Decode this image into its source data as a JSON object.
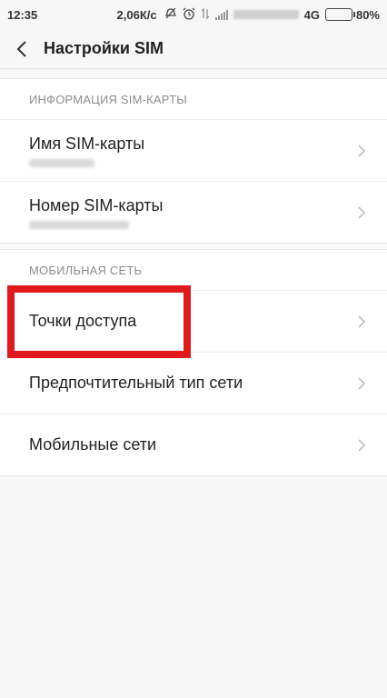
{
  "status_bar": {
    "time": "12:35",
    "speed": "2,06К/с",
    "network": "4G",
    "battery_percent": "80%",
    "battery_level": 0.8
  },
  "header": {
    "title": "Настройки SIM"
  },
  "sim_info": {
    "section_title": "ИНФОРМАЦИЯ SIM-КАРТЫ",
    "items": [
      {
        "label": "Имя SIM-карты"
      },
      {
        "label": "Номер SIM-карты"
      }
    ]
  },
  "mobile_network": {
    "section_title": "МОБИЛЬНАЯ СЕТЬ",
    "items": [
      {
        "label": "Точки доступа"
      },
      {
        "label": "Предпочтительный тип сети"
      },
      {
        "label": "Мобильные сети"
      }
    ]
  },
  "colors": {
    "highlight": "#e0191b",
    "battery": "#f39c12"
  }
}
